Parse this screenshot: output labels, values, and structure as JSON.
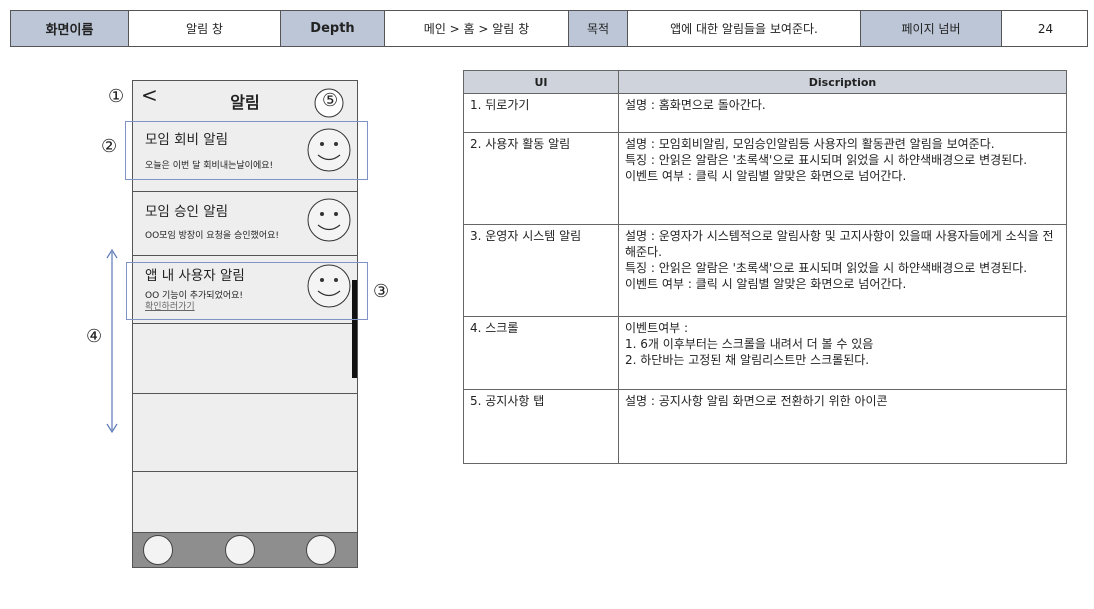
{
  "header": {
    "screen_name_label": "화면이름",
    "screen_name": "알림 창",
    "depth_label": "Depth",
    "depth": "메인 > 홈 > 알림 창",
    "purpose_label": "목적",
    "purpose": "앱에 대한 알림들을 보여준다.",
    "page_number_label": "페이지 넘버",
    "page_number": "24"
  },
  "phone": {
    "back": "<",
    "title": "알림",
    "notifications": [
      {
        "title": "모임 회비 알림",
        "subtitle": "오늘은 이번 달 회비내는날이에요!"
      },
      {
        "title": "모임 승인 알림",
        "subtitle": "OO모임 방장이 요청을 승인했어요!"
      },
      {
        "title": "앱 내 사용자 알림",
        "subtitle": "OO 기능이 추가되었어요!",
        "link": "확인하러가기"
      }
    ]
  },
  "markers": [
    "①",
    "②",
    "③",
    "④",
    "⑤"
  ],
  "table": {
    "headers": [
      "UI",
      "Discription"
    ],
    "rows": [
      {
        "ui": "1. 뒤로가기",
        "desc": [
          "설명 : 홈화면으로 돌아간다."
        ]
      },
      {
        "ui": "2. 사용자 활동 알림",
        "desc": [
          "설명 : 모임회비알림, 모임승인알림등 사용자의 활동관련 알림을 보여준다.",
          "특징 : 안읽은 알람은 '초록색'으로 표시되며 읽었을 시 하얀색배경으로 변경된다.",
          "이벤트 여부 : 클릭 시 알림별 알맞은 화면으로 넘어간다."
        ]
      },
      {
        "ui": "3. 운영자 시스템 알림",
        "desc": [
          "설명 : 운영자가 시스템적으로 알림사항 및 고지사항이 있을때 사용자들에게 소식을 전해준다.",
          "특징 : 안읽은 알람은 '초록색'으로 표시되며 읽었을 시 하얀색배경으로 변경된다.",
          "이벤트 여부 : 클릭 시 알림별 알맞은 화면으로 넘어간다."
        ]
      },
      {
        "ui": "4. 스크롤",
        "desc": [
          "이벤트여부 :",
          "1.  6개 이후부터는 스크롤을 내려서 더 볼 수 있음",
          "2.  하단바는 고정된 채 알림리스트만 스크롤된다."
        ]
      },
      {
        "ui": "5. 공지사항 탭",
        "desc": [
          "설명 : 공지사항 알림 화면으로 전환하기 위한 아이콘"
        ]
      }
    ]
  }
}
